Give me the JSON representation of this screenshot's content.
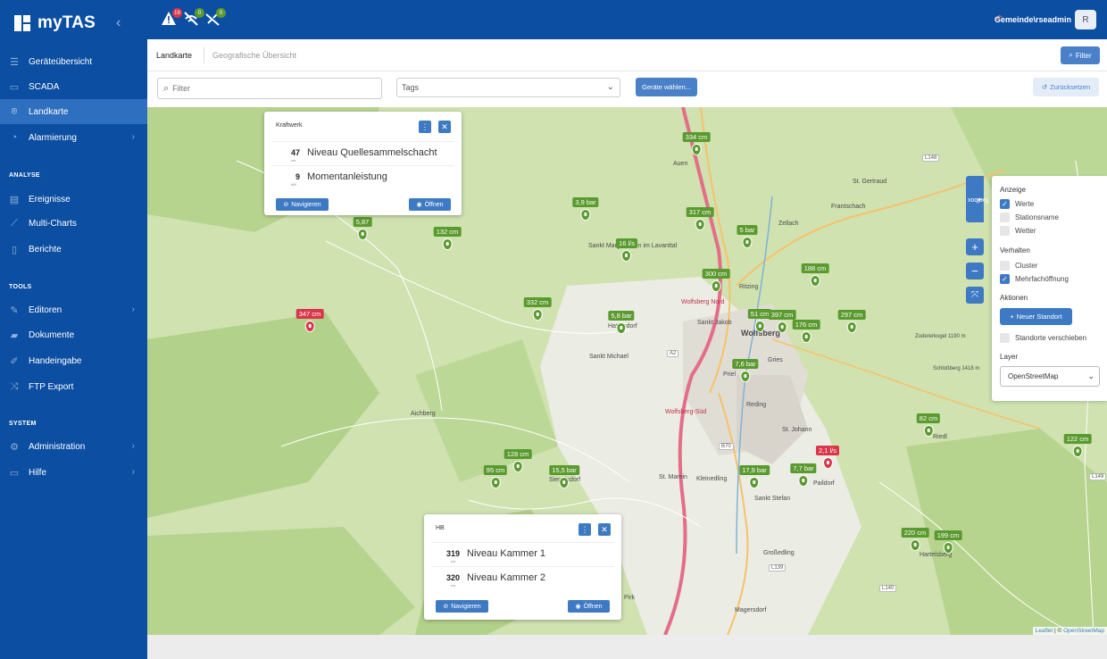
{
  "brand": {
    "name": "myTAS"
  },
  "sidebar": {
    "items": [
      {
        "label": "Geräteübersicht",
        "icon": "list-icon"
      },
      {
        "label": "SCADA",
        "icon": "monitor-icon"
      },
      {
        "label": "Landkarte",
        "icon": "map-pin-icon"
      },
      {
        "label": "Alarmierung",
        "icon": "bell-icon"
      }
    ],
    "sections": {
      "analyse": "ANALYSE",
      "tools": "TOOLS",
      "system": "SYSTEM"
    },
    "analyse_items": [
      {
        "label": "Ereignisse"
      },
      {
        "label": "Multi-Charts"
      },
      {
        "label": "Berichte"
      }
    ],
    "tools_items": [
      {
        "label": "Editoren"
      },
      {
        "label": "Dokumente"
      },
      {
        "label": "Handeingabe"
      },
      {
        "label": "FTP Export"
      }
    ],
    "system_items": [
      {
        "label": "Administration"
      },
      {
        "label": "Hilfe"
      }
    ]
  },
  "topbar": {
    "alerts": [
      {
        "count": "19",
        "color": "#d9364b",
        "icon": "warning-icon"
      },
      {
        "count": "0",
        "color": "#5a9a2f",
        "icon": "no-signal-icon"
      },
      {
        "count": "0",
        "color": "#5a9a2f",
        "icon": "no-connection-icon"
      }
    ],
    "user": "Gemeinde\\rseadmin",
    "avatar": "R"
  },
  "tabs": {
    "active": "Landkarte",
    "inactive": "Geografische Übersicht",
    "filter_button": "Filter"
  },
  "filters": {
    "search_placeholder": "Filter",
    "tags_label": "Tags",
    "select_devices": "Geräte wählen...",
    "reset": "Zurücksetzen"
  },
  "map": {
    "markers": [
      {
        "value": "334 cm",
        "status": "ok"
      },
      {
        "value": "3,9 bar",
        "status": "ok"
      },
      {
        "value": "317 cm",
        "status": "ok"
      },
      {
        "value": "16 l/s",
        "status": "ok"
      },
      {
        "value": "5 bar",
        "status": "ok"
      },
      {
        "value": "132 cm",
        "status": "ok"
      },
      {
        "value": "300 cm",
        "status": "ok"
      },
      {
        "value": "188 cm",
        "status": "ok"
      },
      {
        "value": "332 cm",
        "status": "ok"
      },
      {
        "value": "5,8 bar",
        "status": "ok"
      },
      {
        "value": "51 cm",
        "status": "ok"
      },
      {
        "value": "397 cm",
        "status": "ok"
      },
      {
        "value": "176 cm",
        "status": "ok"
      },
      {
        "value": "297 cm",
        "status": "ok"
      },
      {
        "value": "347 cm",
        "status": "alarm"
      },
      {
        "value": "7,6 bar",
        "status": "ok"
      },
      {
        "value": "82 cm",
        "status": "ok"
      },
      {
        "value": "2,1 l/s",
        "status": "alarm"
      },
      {
        "value": "122 cm",
        "status": "ok"
      },
      {
        "value": "128 cm",
        "status": "ok"
      },
      {
        "value": "95 cm",
        "status": "ok"
      },
      {
        "value": "15,5 bar",
        "status": "ok"
      },
      {
        "value": "17,9 bar",
        "status": "ok"
      },
      {
        "value": "7,7 bar",
        "status": "ok"
      },
      {
        "value": "220 cm",
        "status": "ok"
      },
      {
        "value": "199 cm",
        "status": "ok"
      },
      {
        "value": "5,87",
        "status": "ok"
      }
    ],
    "places": [
      "Auen",
      "St. Gertraud",
      "Frantschach",
      "Zellach",
      "Sankt Margarethen im Lavanttal",
      "Ritzing",
      "Sankt Jakob",
      "Wolfsberg",
      "Gries",
      "Priel",
      "Sankt Michael",
      "Reding",
      "St. Johann",
      "Aichberg",
      "St. Marein",
      "Kleinedling",
      "Sankt Stefan",
      "Paildorf",
      "Großedling",
      "Hartelsberg",
      "Magersdorf",
      "Pirk",
      "Riedl",
      "Siegelsdorf",
      "Hattendorf",
      "Zodererkogel 1190 m",
      "Schloßberg 1418 m"
    ],
    "road_labels": [
      "L148",
      "A2",
      "B70",
      "L139",
      "L140",
      "L149"
    ],
    "highway_labels": [
      "Wolfsberg Nord",
      "Wolfsberg-Süd"
    ],
    "attribution_leaflet": "Leaflet",
    "attribution_osm": "OpenStreetMap"
  },
  "popups": {
    "kraftwerk": {
      "title": "Kraftwerk",
      "rows": [
        {
          "value": "47",
          "unit": "cm",
          "label": "Niveau Quellesammelschacht"
        },
        {
          "value": "9",
          "unit": "kW",
          "label": "Momentanleistung"
        }
      ],
      "navigate": "Navigieren",
      "open": "Öffnen"
    },
    "hb": {
      "title": "HB",
      "rows": [
        {
          "value": "319",
          "unit": "cm",
          "label": "Niveau Kammer 1"
        },
        {
          "value": "320",
          "unit": "cm",
          "label": "Niveau Kammer 2"
        }
      ],
      "navigate": "Navigieren",
      "open": "Öffnen"
    }
  },
  "toolbox": {
    "tab_label": "Toolbox",
    "anzeige": "Anzeige",
    "werte": "Werte",
    "stationsname": "Stationsname",
    "wetter": "Wetter",
    "verhalten": "Verhalten",
    "cluster": "Cluster",
    "mehrfach": "Mehrfachöffnung",
    "aktionen": "Aktionen",
    "neuer_standort": "Neuer Standort",
    "standorte_verschieben": "Standorte verschieben",
    "layer": "Layer",
    "layer_value": "OpenStreetMap",
    "checked": {
      "werte": true,
      "stationsname": false,
      "wetter": false,
      "cluster": false,
      "mehrfach": true,
      "verschieben": false
    }
  }
}
